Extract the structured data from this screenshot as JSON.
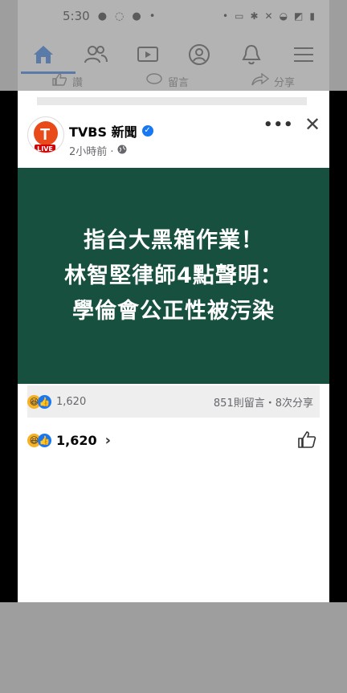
{
  "statusbar": {
    "time": "5:30"
  },
  "feed_behind": {
    "like_label": "讚",
    "comment_label": "留言",
    "share_label": "分享"
  },
  "post": {
    "page_name": "TVBS 新聞",
    "logo_badge": "LIVE",
    "timestamp": "2小時前 · ",
    "more_label": "•••",
    "close_label": "✕",
    "banner_lines": [
      "指台大黑箱作業！",
      "林智堅律師4點聲明：",
      "學倫會公正性被污染"
    ],
    "reactions_count": "1,620",
    "comments_shares": "851則留言・8次分享",
    "reaction_bar_count": "1,620",
    "chevron": "›"
  },
  "icons": [
    "home-icon",
    "friends-icon",
    "video-icon",
    "profile-icon",
    "bell-icon",
    "menu-icon",
    "globe-icon",
    "like-icon",
    "comment-icon",
    "share-icon"
  ],
  "colors": {
    "banner_bg": "#17503f",
    "brand_blue": "#1877f2",
    "live_red": "#d60000"
  }
}
